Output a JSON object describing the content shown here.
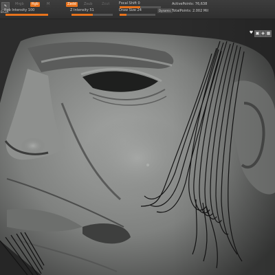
{
  "toolbar": {
    "brush_icon_label": "Brush",
    "mrgb_label": "Mrgb",
    "rgb_label": "Rgb",
    "m_label": "M",
    "zadd_label": "Zadd",
    "zsub_label": "Zsub",
    "zcut_label": "Zcut",
    "rgb_intensity_label": "Rgb Intensity",
    "rgb_intensity_value": "100",
    "rgb_intensity_fraction": 1.0,
    "z_intensity_label": "Z Intensity",
    "z_intensity_value": "51",
    "z_intensity_fraction": 0.51,
    "focal_shift_label": "Focal Shift",
    "focal_shift_value": "0",
    "focal_shift_fraction": 0.5,
    "draw_size_label": "Draw Size",
    "draw_size_value": "24",
    "draw_size_fraction": 0.2,
    "dynamic_label": "Dynamic",
    "active_points_label": "ActivePoints:",
    "active_points_value": "76,638",
    "total_points_label": "TotalPoints:",
    "total_points_value": "2.002 Mil"
  },
  "view_icons": [
    "heart-icon",
    "frame-icon",
    "floor-icon",
    "grid-icon"
  ],
  "colors": {
    "accent": "#e8731c",
    "toolbar_bg": "#363636",
    "viewport_bg": "#2c2c2c",
    "clay": "#8a8c8a"
  }
}
